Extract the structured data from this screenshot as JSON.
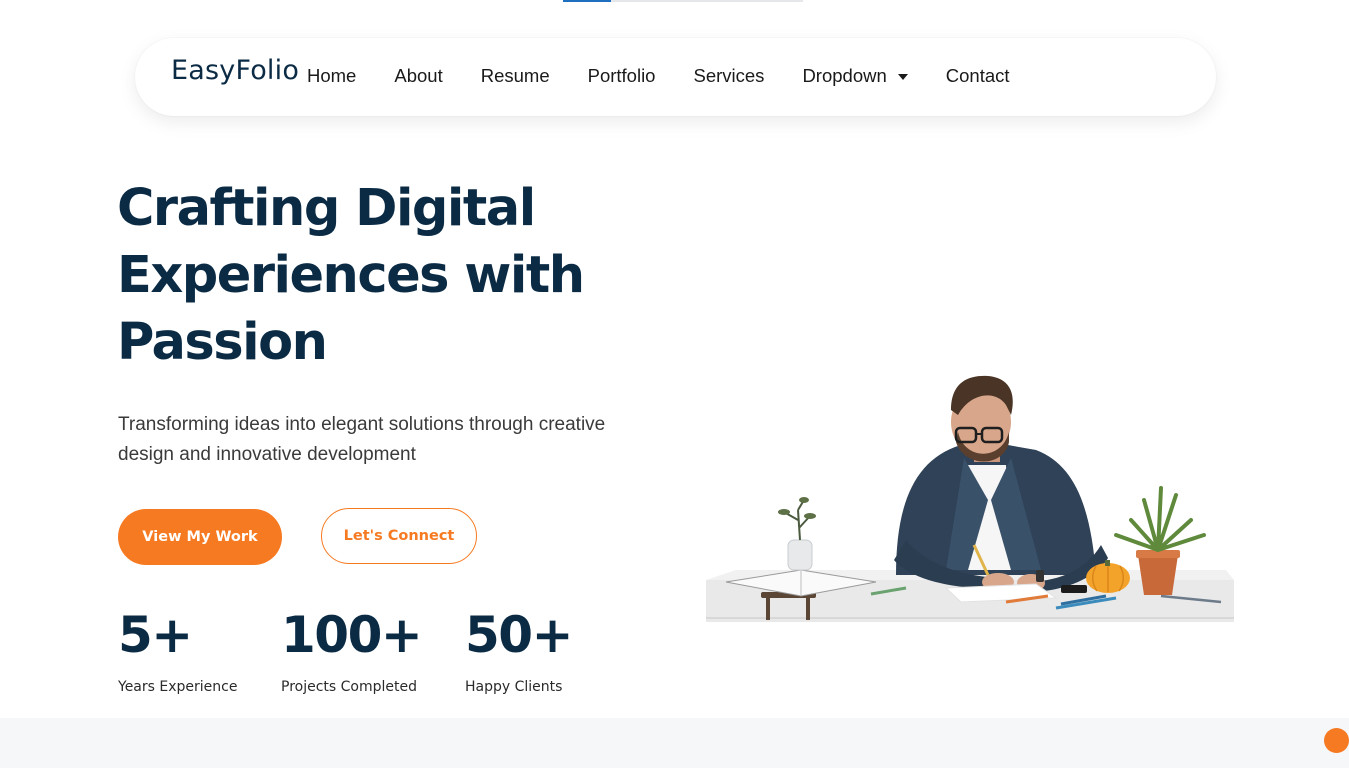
{
  "page_progress": 0.2,
  "navbar": {
    "logo": "EasyFolio",
    "links": [
      {
        "label": "Home"
      },
      {
        "label": "About"
      },
      {
        "label": "Resume"
      },
      {
        "label": "Portfolio"
      },
      {
        "label": "Services"
      },
      {
        "label": "Dropdown",
        "has_caret": true
      },
      {
        "label": "Contact"
      }
    ]
  },
  "hero": {
    "title_lines": [
      "Crafting Digital",
      "Experiences with",
      "Passion"
    ],
    "subtitle": "Transforming ideas into elegant solutions through creative design and innovative development",
    "primary_button": "View My Work",
    "secondary_button": "Let's Connect",
    "stats": [
      {
        "value": "5+",
        "label": "Years Experience"
      },
      {
        "value": "100+",
        "label": "Projects Completed"
      },
      {
        "value": "50+",
        "label": "Happy Clients"
      }
    ]
  },
  "colors": {
    "accent": "#f67a22",
    "heading": "#0b2b45",
    "band": "#f6f7f9"
  },
  "icons": {
    "dropdown": "caret-down-icon",
    "scroll_top": "scroll-to-top-button"
  }
}
